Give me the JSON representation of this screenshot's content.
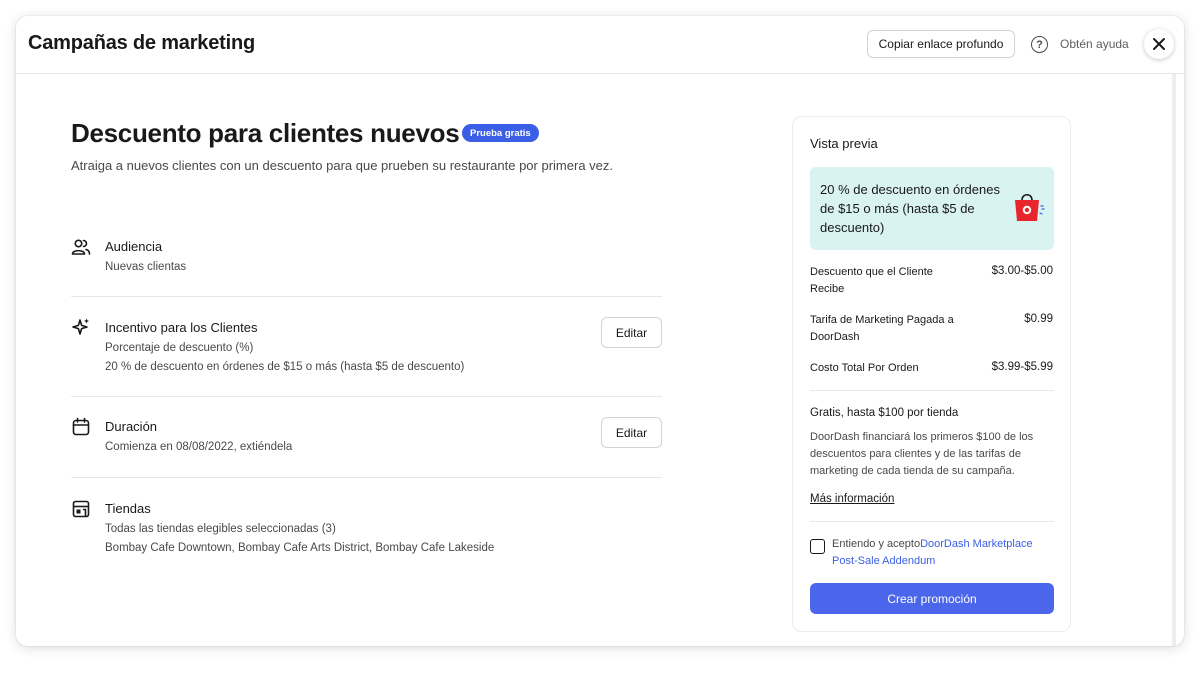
{
  "header": {
    "title": "Campañas de marketing",
    "copy_link_label": "Copiar enlace profundo",
    "help_label": "Obtén ayuda",
    "help_icon": "question-circle-icon",
    "close_icon": "close-icon"
  },
  "main": {
    "title": "Descuento para clientes nuevos",
    "badge": "Prueba gratis",
    "subtitle": "Atraiga a nuevos clientes con un descuento para que prueben su restaurante por primera vez.",
    "sections": [
      {
        "icon": "users-icon",
        "title": "Audiencia",
        "lines": [
          "Nuevas clientas"
        ]
      },
      {
        "icon": "sparkle-icon",
        "title": "Incentivo para los Clientes",
        "lines": [
          "Porcentaje de descuento (%)",
          "20 % de descuento en órdenes de $15 o más (hasta $5 de descuento)"
        ],
        "edit_label": "Editar"
      },
      {
        "icon": "calendar-icon",
        "title": "Duración",
        "lines": [
          "Comienza en 08/08/2022, extiéndela"
        ],
        "edit_label": "Editar"
      },
      {
        "icon": "store-icon",
        "title": "Tiendas",
        "lines": [
          "Todas las tiendas elegibles seleccionadas (3)",
          "Bombay Cafe Downtown, Bombay Cafe Arts District, Bombay Cafe Lakeside"
        ]
      }
    ]
  },
  "preview": {
    "title": "Vista previa",
    "card_text": "20 % de descuento en órdenes de $15 o más (hasta $5 de descuento)",
    "card_icon": "shopping-bag-icon",
    "fees": [
      {
        "label": "Descuento que el Cliente Recibe",
        "value": "$3.00-$5.00"
      },
      {
        "label": "Tarifa de Marketing Pagada a DoorDash",
        "value": "$0.99"
      },
      {
        "label": "Costo Total Por Orden",
        "value": "$3.99-$5.99"
      }
    ],
    "free_title": "Gratis, hasta $100 por tienda",
    "free_desc": "DoorDash financiará los primeros $100 de los descuentos para clientes y de las tarifas de marketing de cada tienda de su campaña.",
    "more_info": "Más información",
    "agree_prefix": "Entiendo y acepto",
    "agree_link": "DoorDash Marketplace Post-Sale Addendum",
    "agree_checked": false,
    "create_label": "Crear promoción"
  },
  "colors": {
    "accent": "#4b66ea",
    "badge": "#3b5ee6",
    "preview_card": "#d9f2f2",
    "bag": "#e8252c"
  }
}
